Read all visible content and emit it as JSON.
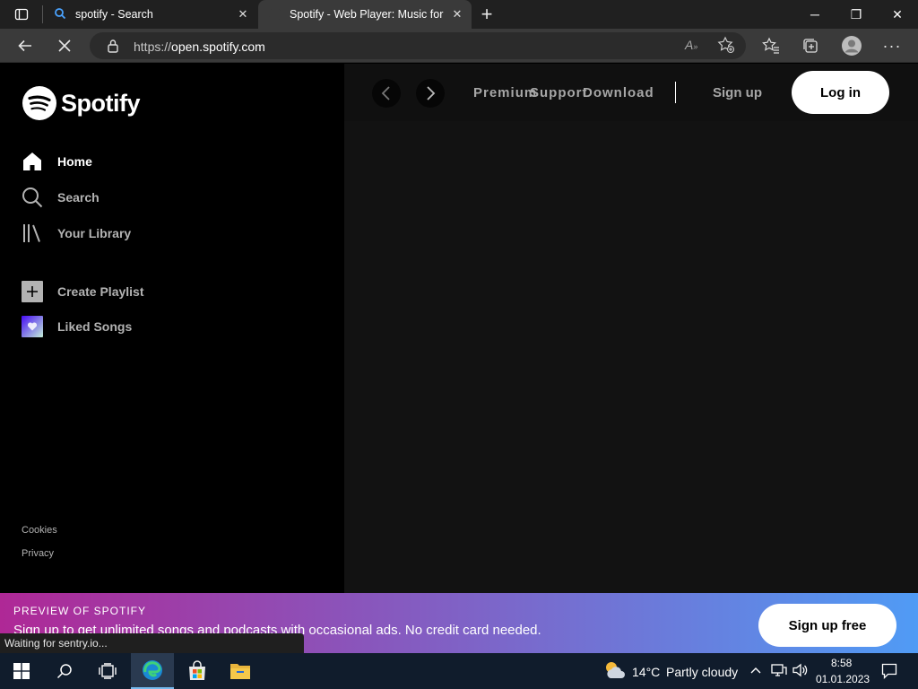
{
  "browser": {
    "tabs": [
      {
        "title": "spotify - Search",
        "active": false
      },
      {
        "title": "Spotify - Web Player: Music for everyone",
        "active": true
      }
    ],
    "new_tab_symbol": "+",
    "url_scheme": "https://",
    "url_host": "open.spotify.com",
    "icons": [
      "tab-actions-icon",
      "search-favicon",
      "spotify-favicon",
      "back-icon",
      "stop-loading-icon",
      "lock-icon",
      "read-aloud-icon",
      "add-favorite-icon",
      "favorites-icon",
      "collections-icon",
      "profile-icon",
      "menu-icon"
    ],
    "window_controls": {
      "minimize": "─",
      "restore": "❐",
      "close": "✕"
    }
  },
  "spotify": {
    "logo_text": "Spotify",
    "nav": [
      {
        "label": "Home",
        "icon": "home-icon",
        "active": true
      },
      {
        "label": "Search",
        "icon": "search-icon",
        "active": false
      },
      {
        "label": "Your Library",
        "icon": "library-icon",
        "active": false
      }
    ],
    "actions": [
      {
        "label": "Create Playlist",
        "icon": "plus-icon"
      },
      {
        "label": "Liked Songs",
        "icon": "heart-icon"
      }
    ],
    "footer": [
      "Cookies",
      "Privacy"
    ],
    "topbar": {
      "links": [
        "Premium",
        "Support",
        "Download"
      ],
      "signup": "Sign up",
      "login": "Log in"
    },
    "banner": {
      "eyebrow": "PREVIEW OF SPOTIFY",
      "text": "Sign up to get unlimited songs and podcasts with occasional ads. No credit card needed.",
      "button": "Sign up free"
    },
    "colors": {
      "brand_green": "#1DB954",
      "banner_from": "#af2896",
      "banner_to": "#509bf5"
    }
  },
  "status_text": "Waiting for sentry.io...",
  "taskbar": {
    "weather_temp": "14°C",
    "weather_desc": "Partly cloudy",
    "time": "8:58",
    "date": "01.01.2023",
    "apps": [
      "windows-start-icon",
      "search-icon",
      "task-view-icon",
      "edge-icon",
      "store-icon",
      "file-explorer-icon"
    ]
  }
}
